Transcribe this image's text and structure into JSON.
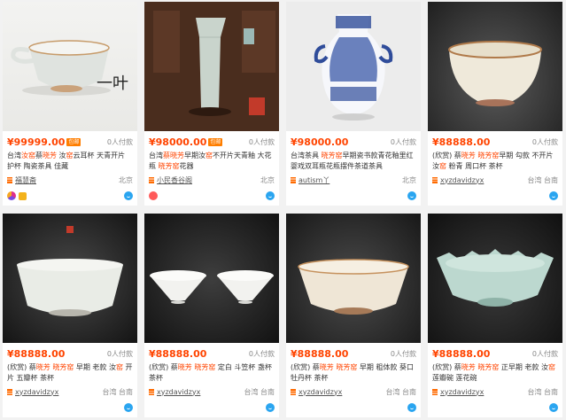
{
  "products": [
    {
      "price": "¥99999.00",
      "badge": "包邮",
      "buyers": "0人付款",
      "title_parts": [
        "台湾",
        "汝窑",
        "蔡",
        "晓芳",
        " 汝",
        "窑",
        "云耳杯 天青开片 护杯 陶瓷茶具 佳藏"
      ],
      "shop": "福慧斋",
      "location": "北京",
      "watermark": "一叶",
      "image_desc": "celadon-cup-with-handle"
    },
    {
      "price": "¥98000.00",
      "badge": "包邮",
      "buyers": "0人付款",
      "title_parts": [
        "台湾",
        "蔡",
        "晓芳",
        "早期汝",
        "窑",
        "不开片天青釉 大花瓶 ",
        "晓芳",
        "窑",
        "花器"
      ],
      "shop": "小民香谷阁",
      "location": "北京",
      "image_desc": "tall-celadon-vase"
    },
    {
      "price": "¥98000.00",
      "badge": "",
      "buyers": "0人付款",
      "title_parts": [
        "台湾茶具 ",
        "晓芳",
        "窑",
        "早期瓷书款青花釉里红 婴戏双耳瓶花瓶摆件茶道茶具"
      ],
      "shop": "autism丫",
      "location": "北京",
      "image_desc": "blue-white-vase"
    },
    {
      "price": "¥88888.00",
      "badge": "",
      "buyers": "0人付款",
      "title_parts": [
        "(欣赏) 蔡",
        "晓芳",
        " ",
        "晓芳",
        "窑",
        "早期 勾款 不开片 汝",
        "窑",
        " 粉青 周口杯 茶杯"
      ],
      "shop": "xyzdavidzyx",
      "location": "台湾 台南",
      "image_desc": "cream-bowl"
    },
    {
      "price": "¥88888.00",
      "badge": "",
      "buyers": "0人付款",
      "title_parts": [
        "(欣赏) 蔡",
        "晓芳",
        " ",
        "晓芳",
        "窑",
        " 早期 老款 汝",
        "窑",
        " 开片 五瓣杯 茶杯"
      ],
      "shop": "xyzdavidzyx",
      "location": "台湾 台南",
      "image_desc": "lobed-cup"
    },
    {
      "price": "¥88888.00",
      "badge": "",
      "buyers": "0人付款",
      "title_parts": [
        "(欣赏) 蔡",
        "晓芳",
        " ",
        "晓芳",
        "窑",
        " 定白 斗笠杯 盏杯 茶杯"
      ],
      "shop": "xyzdavidzyx",
      "location": "台湾 台南",
      "image_desc": "pair-of-conical-cups"
    },
    {
      "price": "¥88888.00",
      "badge": "",
      "buyers": "0人付款",
      "title_parts": [
        "(欣赏) 蔡",
        "晓芳",
        " ",
        "晓芳",
        "窑",
        " 早期 粗体款 葵口 牡丹杯 茶杯"
      ],
      "shop": "xyzdavidzyx",
      "location": "台湾 台南",
      "image_desc": "flower-rim-cup"
    },
    {
      "price": "¥88888.00",
      "badge": "",
      "buyers": "0人付款",
      "title_parts": [
        "(欣赏) 蔡",
        "晓芳",
        " ",
        "晓芳",
        "窑",
        " 正早期 老款 汝",
        "窑",
        " 莲瓣碗 莲花碗"
      ],
      "shop": "xyzdavidzyx",
      "location": "台湾 台南",
      "image_desc": "lotus-bowl"
    }
  ],
  "colors": {
    "price": "#ff4400",
    "badge_bg": "#ff7e00",
    "wangwang": "#2aa5f0",
    "page_bg": "#f2f2f2"
  }
}
